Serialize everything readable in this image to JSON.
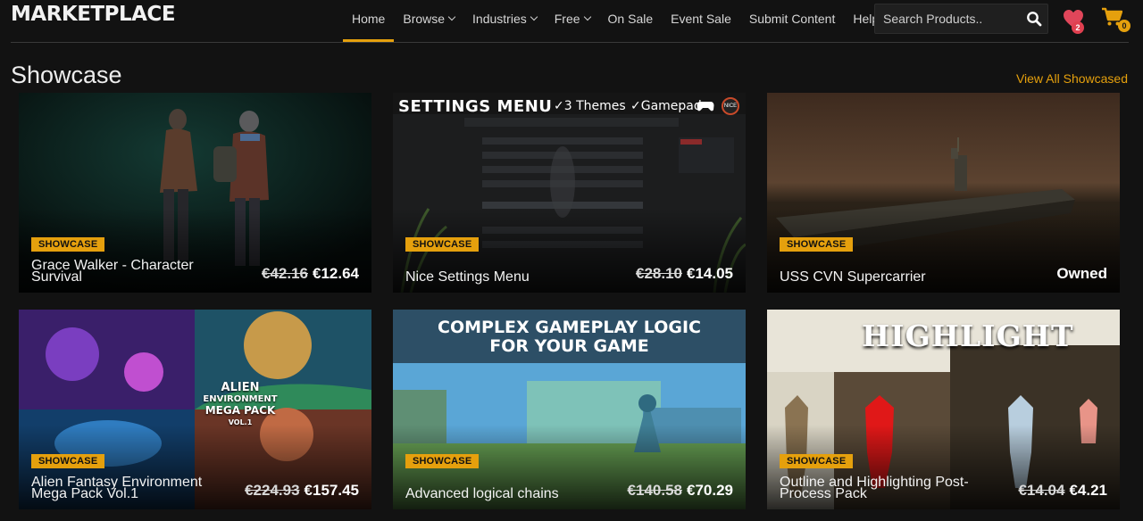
{
  "header": {
    "logo": "MARKETPLACE",
    "nav": [
      {
        "label": "Home",
        "active": true,
        "dropdown": false
      },
      {
        "label": "Browse",
        "active": false,
        "dropdown": true
      },
      {
        "label": "Industries",
        "active": false,
        "dropdown": true
      },
      {
        "label": "Free",
        "active": false,
        "dropdown": true
      },
      {
        "label": "On Sale",
        "active": false,
        "dropdown": false
      },
      {
        "label": "Event Sale",
        "active": false,
        "dropdown": false
      },
      {
        "label": "Submit Content",
        "active": false,
        "dropdown": false
      },
      {
        "label": "Help",
        "active": false,
        "dropdown": false
      }
    ],
    "search_placeholder": "Search Products..",
    "wishlist_count": "2",
    "cart_count": "0",
    "accent": "#e5a00d"
  },
  "section": {
    "title": "Showcase",
    "view_all": "View All Showcased"
  },
  "cards": [
    {
      "tag": "SHOWCASE",
      "title": "Grace Walker - Character Survival",
      "old_price": "€42.16",
      "price": "€12.64"
    },
    {
      "tag": "SHOWCASE",
      "title": "Nice Settings Menu",
      "old_price": "€28.10",
      "price": "€14.05",
      "art": {
        "heading": "SETTINGS MENU",
        "feature1": "✓3 Themes",
        "feature2": "✓Gamepad"
      }
    },
    {
      "tag": "SHOWCASE",
      "title": "USS CVN Supercarrier",
      "status": "Owned"
    },
    {
      "tag": "SHOWCASE",
      "title": "Alien Fantasy Environment Mega Pack Vol.1",
      "old_price": "€224.93",
      "price": "€157.45",
      "art": {
        "line1": "ALIEN",
        "line2": "ENVIRONMENT",
        "line3": "MEGA PACK",
        "line4": "VOL.1"
      }
    },
    {
      "tag": "SHOWCASE",
      "title": "Advanced logical chains",
      "old_price": "€140.58",
      "price": "€70.29",
      "art": {
        "line1": "COMPLEX GAMEPLAY LOGIC",
        "line2": "FOR YOUR GAME"
      }
    },
    {
      "tag": "SHOWCASE",
      "title": "Outline and Highlighting Post-Process Pack",
      "old_price": "€14.04",
      "price": "€4.21",
      "art": {
        "heading": "HIGHLIGHT"
      }
    }
  ]
}
